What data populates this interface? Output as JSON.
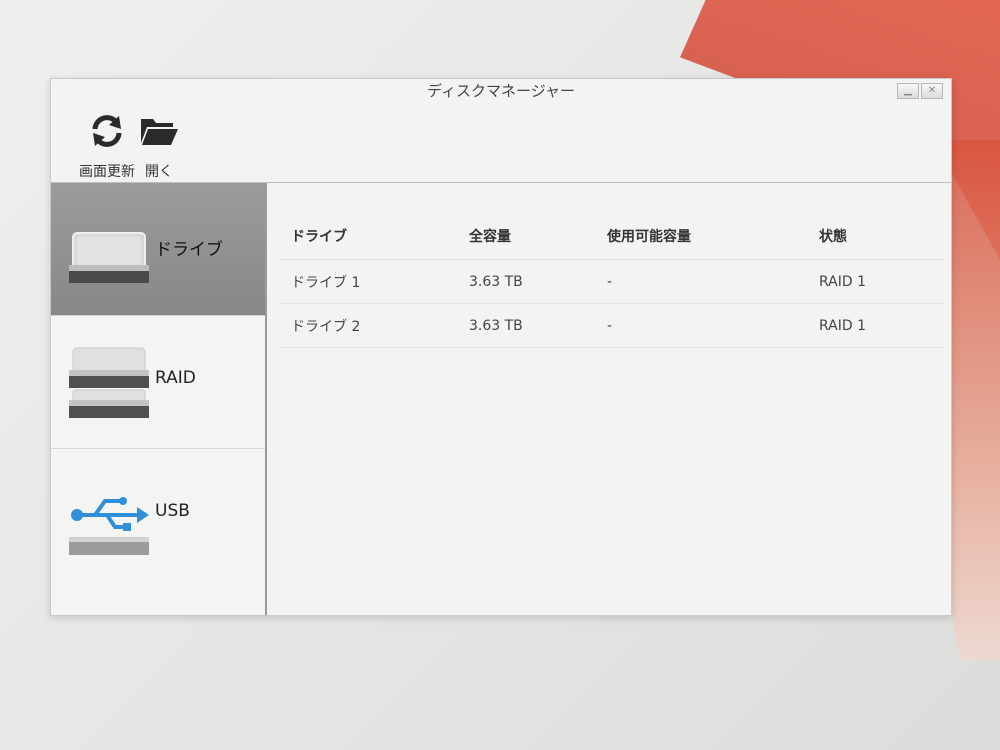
{
  "window": {
    "title": "ディスクマネージャー"
  },
  "toolbar": {
    "refresh_label": "画面更新",
    "open_label": "開く",
    "refresh_icon": "refresh-icon",
    "open_icon": "folder-open-icon"
  },
  "sidebar": {
    "items": [
      {
        "label": "ドライブ",
        "icon": "hard-drive-icon",
        "active": true
      },
      {
        "label": "RAID",
        "icon": "raid-array-icon",
        "active": false
      },
      {
        "label": "USB",
        "icon": "usb-icon",
        "active": false
      }
    ]
  },
  "table": {
    "headers": [
      "ドライブ",
      "全容量",
      "使用可能容量",
      "状態"
    ],
    "rows": [
      {
        "drive": "ドライブ 1",
        "capacity": "3.63 TB",
        "available": "-",
        "status": "RAID 1"
      },
      {
        "drive": "ドライブ 2",
        "capacity": "3.63 TB",
        "available": "-",
        "status": "RAID 1"
      }
    ]
  },
  "colors": {
    "accent_usb": "#2f8fd8",
    "active_bg": "#929290"
  }
}
